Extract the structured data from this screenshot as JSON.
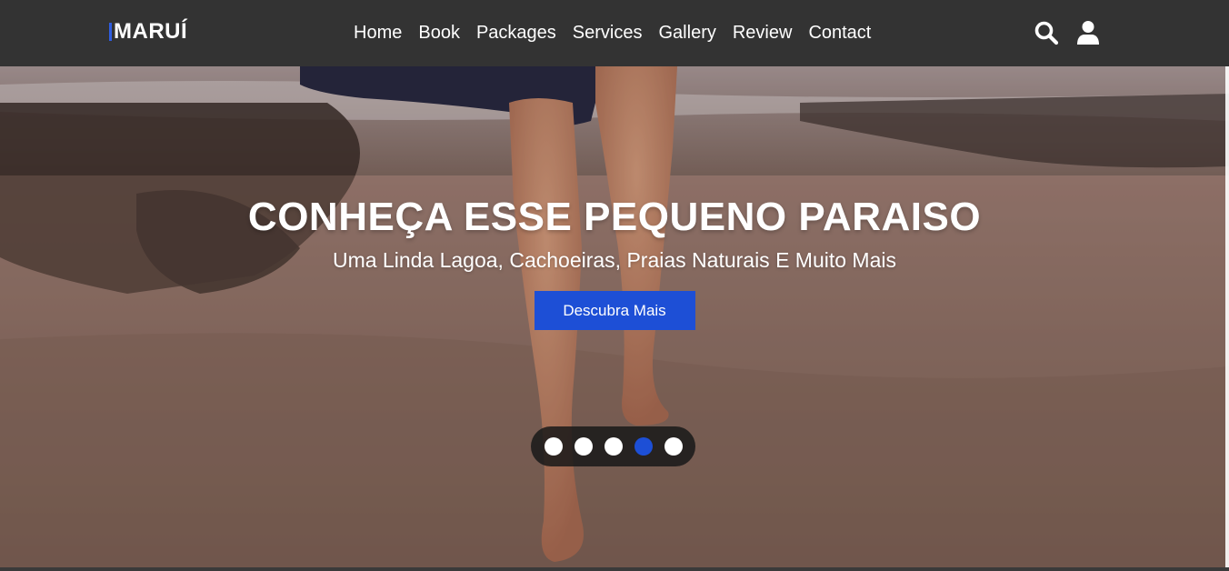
{
  "brand": {
    "name": "MARUÍ",
    "accent": "#2f5de0"
  },
  "nav": {
    "items": [
      {
        "label": "Home"
      },
      {
        "label": "Book"
      },
      {
        "label": "Packages"
      },
      {
        "label": "Services"
      },
      {
        "label": "Gallery"
      },
      {
        "label": "Review"
      },
      {
        "label": "Contact"
      }
    ]
  },
  "header_icons": {
    "search": "search-icon",
    "user": "user-icon"
  },
  "hero": {
    "title": "CONHEÇA ESSE PEQUENO PARAISO",
    "subtitle": "Uma Linda Lagoa, Cachoeiras, Praias Naturais E Muito Mais",
    "cta_label": "Descubra Mais",
    "background": "beach-walk-photo"
  },
  "carousel": {
    "total_slides": 5,
    "active_index": 4
  },
  "colors": {
    "header_bg": "#333333",
    "button": "#1d4fd6"
  }
}
